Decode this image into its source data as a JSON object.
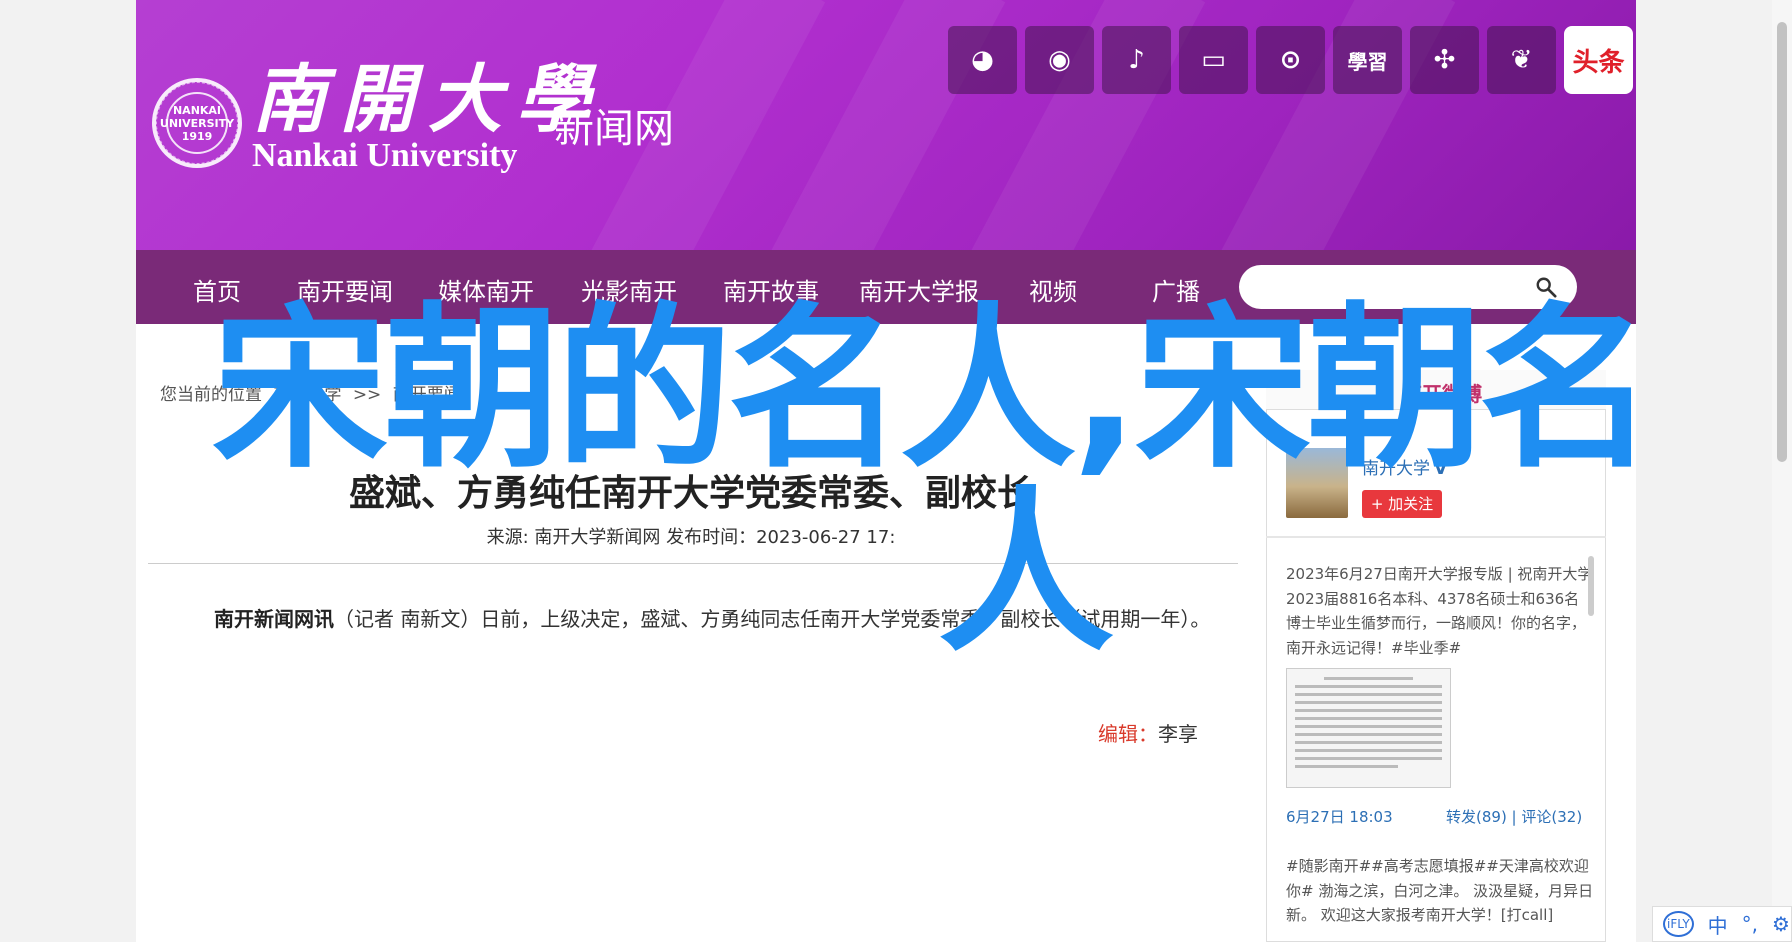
{
  "header": {
    "logo_cn": "南開大學",
    "logo_en": "Nankai University",
    "logo_sub": "新闻网",
    "seal_text": "NANKAI UNIVERSITY 1919",
    "social": [
      {
        "icon": "wechat-icon",
        "glyph": "◕"
      },
      {
        "icon": "weibo-icon",
        "glyph": "◉"
      },
      {
        "icon": "douyin-icon",
        "glyph": "♪"
      },
      {
        "icon": "bilibili-icon",
        "glyph": "▭"
      },
      {
        "icon": "kuaishou-icon",
        "glyph": "⊙"
      },
      {
        "icon": "xuexi-icon",
        "glyph": "學習"
      },
      {
        "icon": "network-icon",
        "glyph": "✣"
      },
      {
        "icon": "plant-icon",
        "glyph": "❦"
      },
      {
        "icon": "toutiao-icon",
        "glyph": "头条"
      }
    ]
  },
  "nav": {
    "items": [
      "首页",
      "南开要闻",
      "媒体南开",
      "光影南开",
      "南开故事",
      "南开大学报",
      "视频",
      "广播"
    ],
    "search_placeholder": ""
  },
  "breadcrumb": [
    "您当前的位置",
    "南开大学",
    ">>",
    "南开要闻"
  ],
  "article": {
    "title": "盛斌、方勇纯任南开大学党委常委、副校长",
    "meta": "来源:  南开大学新闻网  发布时间：2023-06-27 17:",
    "lead_bold": "南开新闻网讯",
    "lead_text": "（记者 南新文）日前，上级决定，盛斌、方勇纯同志任南开大学党委常委、副校长（试用期一年）。",
    "editor_label": "编辑：",
    "editor_name": "李享"
  },
  "panel": {
    "tab": "南开微博",
    "account": "南开大学",
    "verified": "V",
    "follow": "+ 加关注",
    "post1": "2023年6月27日南开大学报专版 | 祝南开大学2023届8816名本科、4378名硕士和636名博士毕业生循梦而行，一路顺风！你的名字，南开永远记得！#毕业季#",
    "post1_date": "6月27日 18:03",
    "post1_stats": "转发(89)  |  评论(32)",
    "post2": "#随影南开##高考志愿填报##天津高校欢迎你# 渤海之滨，白河之津。 汲汲星疑，月异日新。 欢迎这大家报考南开大学！[打call]"
  },
  "overlay": {
    "line1": "宋朝的名人,宋朝名",
    "line2": "人"
  },
  "ime": {
    "logo": "iFLY",
    "lang": "中",
    "dot": "°,",
    "gear": "⚙"
  }
}
